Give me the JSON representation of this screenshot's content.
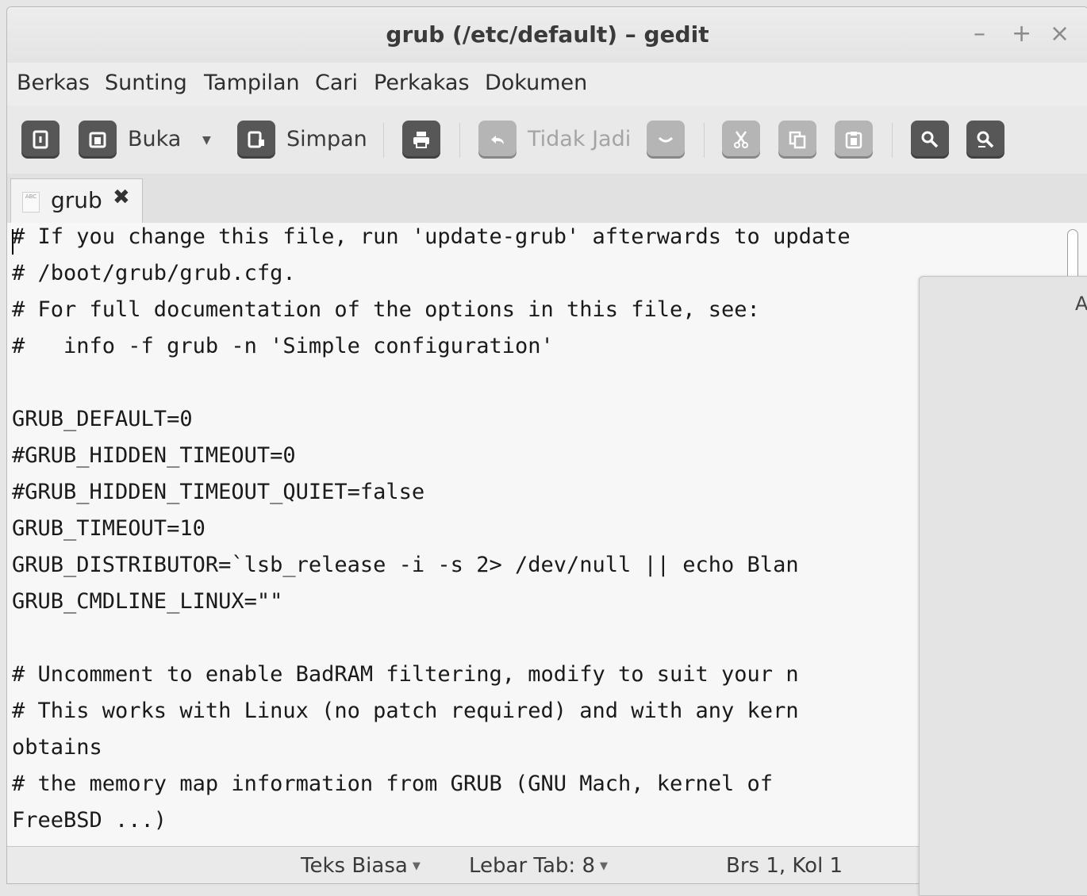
{
  "window": {
    "title": "grub (/etc/default) – gedit",
    "controls": {
      "minimize": "–",
      "maximize": "+",
      "close": "×"
    }
  },
  "menu": [
    "Berkas",
    "Sunting",
    "Tampilan",
    "Cari",
    "Perkakas",
    "Dokumen"
  ],
  "toolbar": {
    "open_label": "Buka",
    "save_label": "Simpan",
    "undo_label": "Tidak Jadi",
    "icons": [
      "new-document-icon",
      "open-icon",
      "save-icon",
      "print-icon",
      "undo-icon",
      "redo-icon",
      "cut-icon",
      "copy-icon",
      "paste-icon",
      "search-icon",
      "search-replace-icon"
    ]
  },
  "tab": {
    "label": "grub",
    "close": "✖",
    "doc_icon_text": "ABC"
  },
  "editor": {
    "lines": [
      "# If you change this file, run 'update-grub' afterwards to update",
      "# /boot/grub/grub.cfg.",
      "# For full documentation of the options in this file, see:",
      "#   info -f grub -n 'Simple configuration'",
      "",
      "GRUB_DEFAULT=0",
      "#GRUB_HIDDEN_TIMEOUT=0",
      "#GRUB_HIDDEN_TIMEOUT_QUIET=false",
      "GRUB_TIMEOUT=10",
      "GRUB_DISTRIBUTOR=`lsb_release -i -s 2> /dev/null || echo Blan",
      "GRUB_CMDLINE_LINUX=\"\"",
      "",
      "# Uncomment to enable BadRAM filtering, modify to suit your n",
      "# This works with Linux (no patch required) and with any kern",
      "obtains",
      "# the memory map information from GRUB (GNU Mach, kernel of",
      "FreeBSD ...)"
    ]
  },
  "popup": {
    "partial_letter": "A"
  },
  "status": {
    "language": "Teks Biasa",
    "tab_width": "Lebar Tab: 8",
    "position": "Brs 1, Kol 1"
  }
}
